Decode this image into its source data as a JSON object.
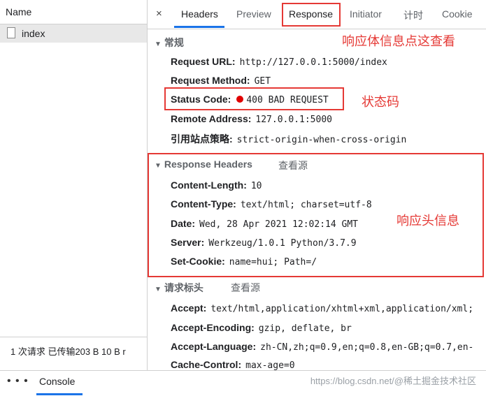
{
  "left_panel": {
    "column_header": "Name",
    "requests": [
      {
        "name": "index"
      }
    ],
    "status": "1 次请求  已传输203 B  10 B r"
  },
  "tabs": {
    "close": "×",
    "items": [
      "Headers",
      "Preview",
      "Response",
      "Initiator",
      "计时",
      "Cookie"
    ],
    "active": "Headers"
  },
  "general": {
    "title": "常规",
    "rows": [
      {
        "key": "Request URL:",
        "value": "http://127.0.0.1:5000/index"
      },
      {
        "key": "Request Method:",
        "value": "GET"
      },
      {
        "key": "Status Code:",
        "value": "400 BAD REQUEST"
      },
      {
        "key": "Remote Address:",
        "value": "127.0.0.1:5000"
      },
      {
        "key": "引用站点策略:",
        "value": "strict-origin-when-cross-origin"
      }
    ]
  },
  "response_headers": {
    "title": "Response Headers",
    "view_source": "查看源",
    "rows": [
      {
        "key": "Content-Length:",
        "value": "10"
      },
      {
        "key": "Content-Type:",
        "value": "text/html; charset=utf-8"
      },
      {
        "key": "Date:",
        "value": "Wed, 28 Apr 2021 12:02:14 GMT"
      },
      {
        "key": "Server:",
        "value": "Werkzeug/1.0.1 Python/3.7.9"
      },
      {
        "key": "Set-Cookie:",
        "value": "name=hui; Path=/"
      }
    ]
  },
  "request_headers": {
    "title": "请求标头",
    "view_source": "查看源",
    "rows": [
      {
        "key": "Accept:",
        "value": "text/html,application/xhtml+xml,application/xml;"
      },
      {
        "key": "Accept-Encoding:",
        "value": "gzip, deflate, br"
      },
      {
        "key": "Accept-Language:",
        "value": "zh-CN,zh;q=0.9,en;q=0.8,en-GB;q=0.7,en-"
      },
      {
        "key": "Cache-Control:",
        "value": "max-age=0"
      }
    ]
  },
  "annotations": {
    "response_note": "响应体信息点这查看",
    "status_note": "状态码",
    "headers_note": "响应头信息",
    "color": "#e53935"
  },
  "bottom_bar": {
    "menu": "⋮",
    "console": "Console",
    "watermark": "https://blog.csdn.net/@稀土掘金技术社区"
  },
  "colors": {
    "status_dot": "#e00000",
    "accent": "#1a73e8"
  }
}
